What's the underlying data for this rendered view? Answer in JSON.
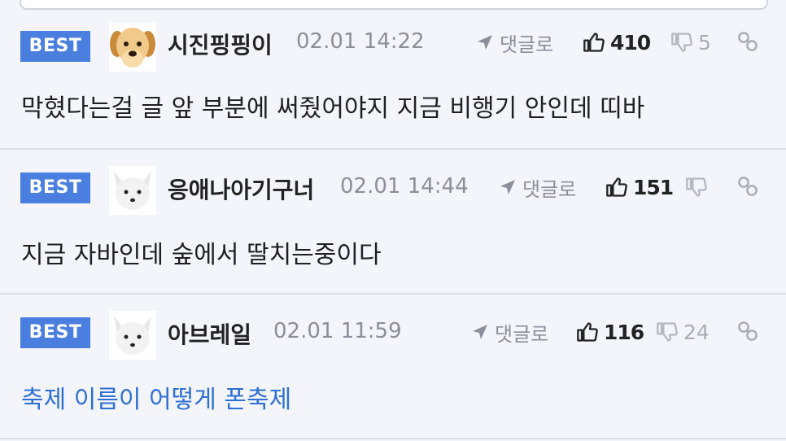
{
  "comments": [
    {
      "badge": "BEST",
      "username": "시진핑핑이",
      "timestamp": "02.01 14:22",
      "reply_label": "댓글로",
      "likes": "410",
      "dislikes": "5",
      "text": "막혔다는걸 글 앞 부분에 써줬어야지 지금 비행기 안인데 띠바",
      "avatar": "puppy-avatar"
    },
    {
      "badge": "BEST",
      "username": "응애나아기구너",
      "timestamp": "02.01 14:44",
      "reply_label": "댓글로",
      "likes": "151",
      "dislikes": "",
      "text": "지금 자바인데 숲에서 딸치는중이다",
      "avatar": "white-fox-avatar"
    },
    {
      "badge": "BEST",
      "username": "아브레일",
      "timestamp": "02.01 11:59",
      "reply_label": "댓글로",
      "likes": "116",
      "dislikes": "24",
      "text": "축제 이름이 어떻게 폰축제",
      "avatar": "white-fox-avatar"
    }
  ],
  "colors": {
    "badge": "#4a7fe0",
    "link_text": "#2f6fd3",
    "meta_gray": "#8a8f99",
    "background": "#f3f5fb"
  }
}
